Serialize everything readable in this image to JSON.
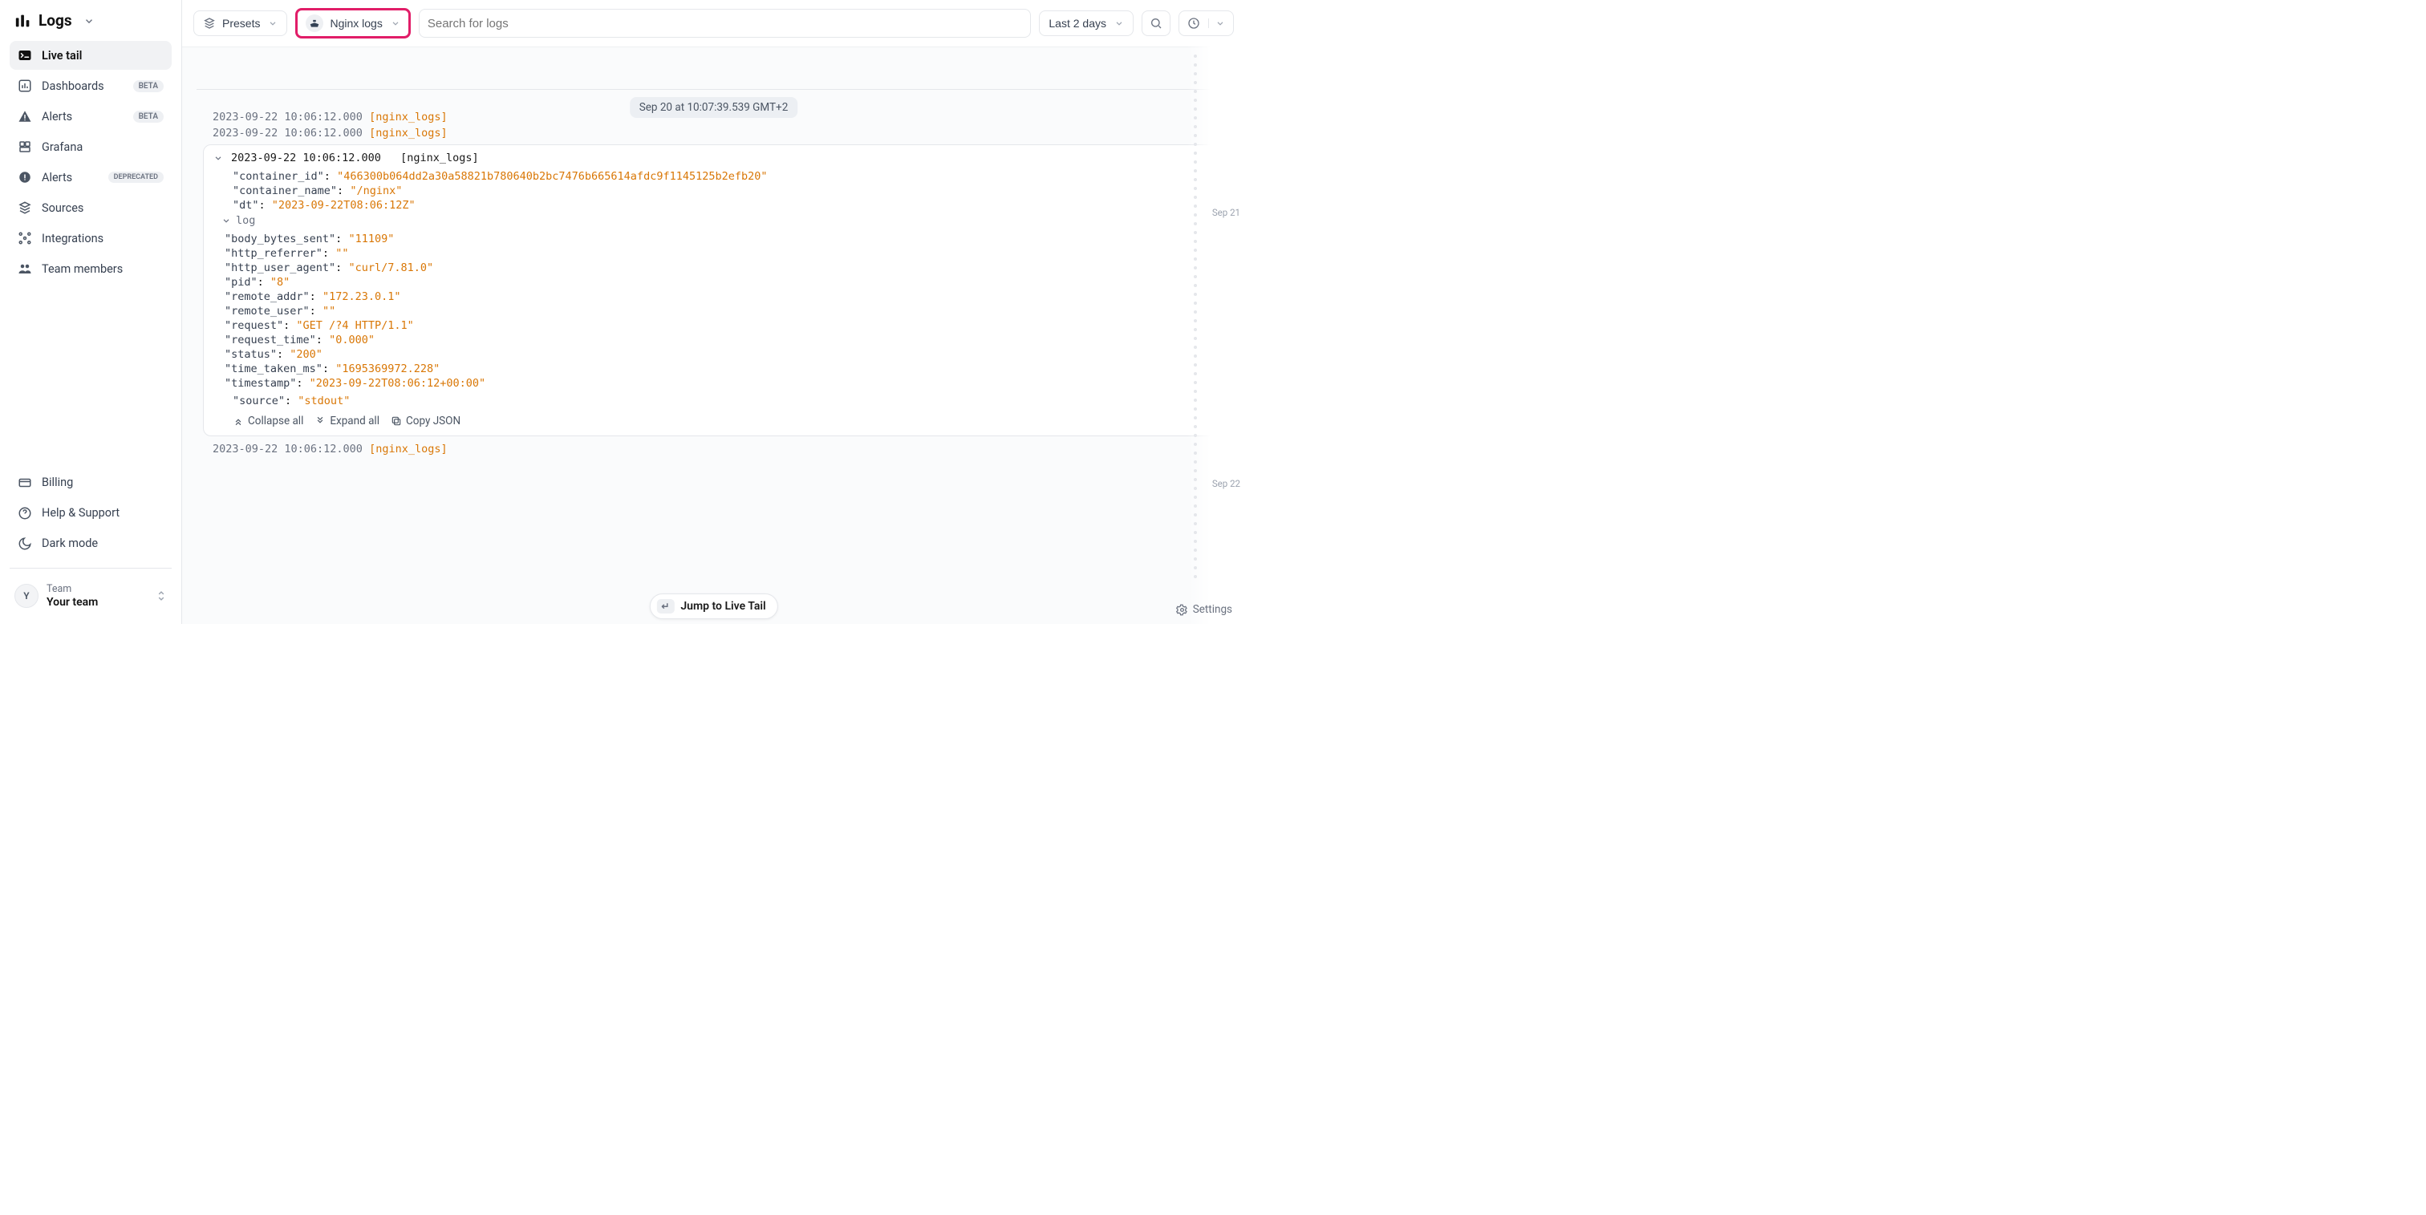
{
  "brand": {
    "title": "Logs"
  },
  "sidebar_items": [
    {
      "label": "Live tail",
      "badge": "",
      "active": true
    },
    {
      "label": "Dashboards",
      "badge": "BETA"
    },
    {
      "label": "Alerts",
      "badge": "BETA"
    },
    {
      "label": "Grafana",
      "badge": ""
    },
    {
      "label": "Alerts",
      "badge": "DEPRECATED"
    },
    {
      "label": "Sources",
      "badge": ""
    },
    {
      "label": "Integrations",
      "badge": ""
    },
    {
      "label": "Team members",
      "badge": ""
    }
  ],
  "sidebar_bottom": [
    {
      "label": "Billing"
    },
    {
      "label": "Help & Support"
    },
    {
      "label": "Dark mode"
    }
  ],
  "team": {
    "avatar_initial": "Y",
    "label": "Team",
    "name": "Your team"
  },
  "topbar": {
    "presets_label": "Presets",
    "source_label": "Nginx logs",
    "search_placeholder": "Search for logs",
    "timerange_label": "Last 2 days"
  },
  "timestamp_pill": "Sep 20 at 10:07:39.539 GMT+2",
  "plain_logs_before": [
    {
      "ts": "2023-09-22 10:06:12.000",
      "src": "[nginx_logs]"
    },
    {
      "ts": "2023-09-22 10:06:12.000",
      "src": "[nginx_logs]"
    }
  ],
  "expanded": {
    "header": {
      "ts": "2023-09-22 10:06:12.000",
      "src": "[nginx_logs]"
    },
    "rows": [
      {
        "k": "container_id",
        "v": "466300b064dd2a30a58821b780640b2bc7476b665614afdc9f1145125b2efb20"
      },
      {
        "k": "container_name",
        "v": "/nginx"
      },
      {
        "k": "dt",
        "v": "2023-09-22T08:06:12Z"
      }
    ],
    "sub_label": "log",
    "sub_rows": [
      {
        "k": "body_bytes_sent",
        "v": "11109"
      },
      {
        "k": "http_referrer",
        "v": ""
      },
      {
        "k": "http_user_agent",
        "v": "curl/7.81.0"
      },
      {
        "k": "pid",
        "v": "8"
      },
      {
        "k": "remote_addr",
        "v": "172.23.0.1"
      },
      {
        "k": "remote_user",
        "v": ""
      },
      {
        "k": "request",
        "v": "GET /?4 HTTP/1.1"
      },
      {
        "k": "request_time",
        "v": "0.000"
      },
      {
        "k": "status",
        "v": "200"
      },
      {
        "k": "time_taken_ms",
        "v": "1695369972.228"
      },
      {
        "k": "timestamp",
        "v": "2023-09-22T08:06:12+00:00"
      }
    ],
    "tail_rows": [
      {
        "k": "source",
        "v": "stdout"
      }
    ],
    "actions": {
      "collapse": "Collapse all",
      "expand": "Expand all",
      "copy": "Copy JSON"
    }
  },
  "plain_logs_after": [
    {
      "ts": "2023-09-22 10:06:12.000",
      "src": "[nginx_logs]"
    }
  ],
  "ruler": {
    "marker1": "Sep 21",
    "marker2": "Sep 22"
  },
  "jump_label": "Jump to Live Tail",
  "jump_key": "↵",
  "settings_label": "Settings"
}
